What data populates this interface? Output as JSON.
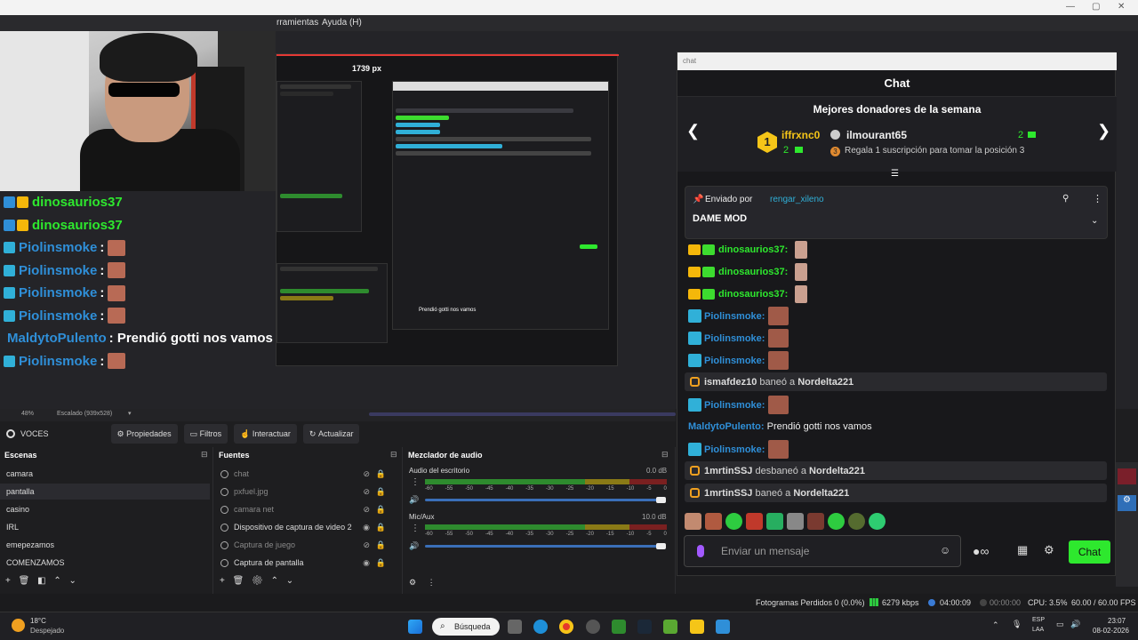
{
  "menu": {
    "tools": "rramientas",
    "help": "Ayuda (H)"
  },
  "overlay": {
    "rows": [
      {
        "name": "dinosaurios37",
        "color": "#2ee82e",
        "msg": "",
        "badges": [
          "#2f8fd8",
          "#f5b70a"
        ]
      },
      {
        "name": "dinosaurios37",
        "color": "#2ee82e",
        "msg": "",
        "badges": [
          "#2f8fd8",
          "#f5b70a"
        ]
      },
      {
        "name": "Piolinsmoke",
        "color": "#2f8fd8",
        "msg": ":",
        "badges": [
          "#30b0d8"
        ]
      },
      {
        "name": "Piolinsmoke",
        "color": "#2f8fd8",
        "msg": ":",
        "badges": [
          "#30b0d8"
        ]
      },
      {
        "name": "Piolinsmoke",
        "color": "#2f8fd8",
        "msg": ":",
        "badges": [
          "#30b0d8"
        ]
      },
      {
        "name": "Piolinsmoke",
        "color": "#2f8fd8",
        "msg": ":",
        "badges": [
          "#30b0d8"
        ]
      },
      {
        "name": "MaldytoPulento",
        "color": "#2f8fd8",
        "msg": ": Prendió gotti nos vamos",
        "badges": []
      },
      {
        "name": "Piolinsmoke",
        "color": "#2f8fd8",
        "msg": ":",
        "badges": [
          "#30b0d8"
        ]
      }
    ],
    "nested_width_label": "1739 px",
    "nested_overlay_text": "Prendió gotti nos vamos"
  },
  "chat": {
    "window_title": "chat",
    "header": "Chat",
    "donors_title": "Mejores donadores de la semana",
    "donor1": {
      "rank": "1",
      "name": "iffrxnc0",
      "count": "2"
    },
    "donor2": {
      "name": "ilmourant65",
      "count": "2",
      "note": "Regala 1 suscripción para tomar la posición 3",
      "note_rank": "3"
    },
    "pinned": {
      "prefix": "Enviado por",
      "user": "rengar_xileno",
      "text": "DAME MOD"
    },
    "messages": [
      {
        "name": "dinosaurios37:",
        "type": "dino"
      },
      {
        "name": "dinosaurios37:",
        "type": "dino"
      },
      {
        "name": "dinosaurios37:",
        "type": "dino"
      },
      {
        "name": "Piolinsmoke:",
        "type": "piolin"
      },
      {
        "name": "Piolinsmoke:",
        "type": "piolin"
      },
      {
        "name": "Piolinsmoke:",
        "type": "piolin"
      }
    ],
    "ban1": {
      "user": "ismafdez10",
      "action": "baneó a",
      "target": "Nordelta221"
    },
    "piolin_after": "Piolinsmoke:",
    "maldyto": {
      "name": "MaldytoPulento:",
      "text": "Prendió gotti nos vamos"
    },
    "piolin_last": "Piolinsmoke:",
    "unban": {
      "user": "1mrtinSSJ",
      "action": "desbaneó a",
      "target": "Nordelta221"
    },
    "ban2": {
      "user": "1mrtinSSJ",
      "action": "baneó a",
      "target": "Nordelta221"
    },
    "input_placeholder": "Enviar un mensaje",
    "send_label": "Chat"
  },
  "obs": {
    "zoom": "48%",
    "scale": "Escalado (939x528)",
    "source_name": "VOCES",
    "buttons": {
      "props": "Propiedades",
      "filters": "Filtros",
      "interact": "Interactuar",
      "refresh": "Actualizar"
    },
    "scenes_title": "Escenas",
    "scenes": [
      "camara",
      "pantalla",
      "casino",
      "IRL",
      "emepezamos",
      "COMENZAMOS"
    ],
    "sources_title": "Fuentes",
    "sources": [
      {
        "name": "chat",
        "visible": false
      },
      {
        "name": "pxfuel.jpg",
        "visible": false
      },
      {
        "name": "camara net",
        "visible": false
      },
      {
        "name": "Dispositivo de captura de video 2",
        "visible": true
      },
      {
        "name": "Captura de juego",
        "visible": false
      },
      {
        "name": "Captura de pantalla",
        "visible": true
      }
    ],
    "mixer_title": "Mezclador de audio",
    "desktop_audio": {
      "label": "Audio del escritorio",
      "db": "0.0 dB"
    },
    "mic_audio": {
      "label": "Mic/Aux",
      "db": "10.0 dB"
    },
    "meter_ticks": [
      "-60",
      "-55",
      "-50",
      "-45",
      "-40",
      "-35",
      "-30",
      "-25",
      "-20",
      "-15",
      "-10",
      "-5",
      "0"
    ]
  },
  "status": {
    "dropped": "Fotogramas Perdidos 0 (0.0%)",
    "bitrate": "6279 kbps",
    "stream_time": "04:00:09",
    "rec_time": "00:00:00",
    "cpu": "CPU: 3.5%",
    "fps": "60.00 / 60.00 FPS"
  },
  "taskbar": {
    "temp": "18°C",
    "weather": "Despejado",
    "search": "Búsqueda",
    "lang1": "ESP",
    "lang2": "LAA",
    "time": "23:07",
    "date": "08-02-2026"
  }
}
